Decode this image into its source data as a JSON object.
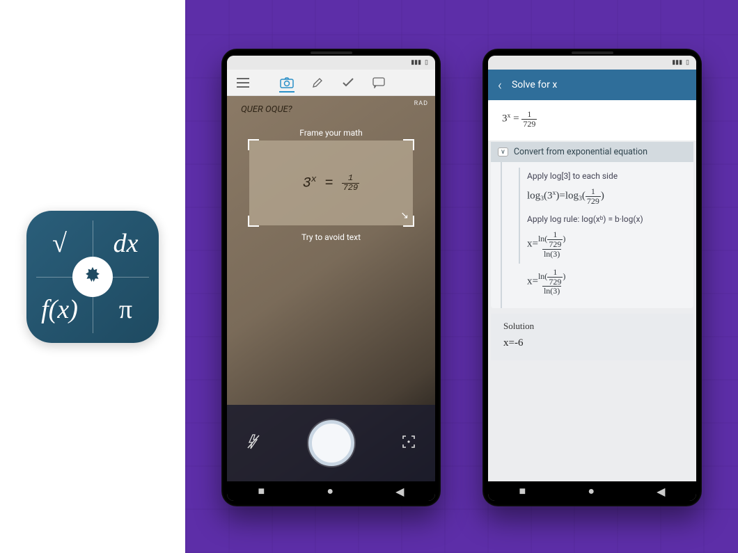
{
  "app_icon": {
    "top_left": "√",
    "top_right": "dx",
    "bottom_left": "f(x)",
    "bottom_right": "π",
    "center_glyph": "leaf-icon"
  },
  "phone1": {
    "status": {
      "signal": "▮▮▮",
      "battery": "▯"
    },
    "tabs": {
      "menu": "menu-icon",
      "camera": "camera-icon",
      "edit": "pencil-icon",
      "check": "check-icon",
      "chat": "chat-icon"
    },
    "camera": {
      "rad": "RAD",
      "frame_label": "Frame your math",
      "avoid_label": "Try to avoid text",
      "captured_expression": "3ˣ = 1⁄729",
      "background_writing": "QUER OQUE?"
    },
    "controls": {
      "flash": "flash-off-icon",
      "capture": "capture-button",
      "fullscreen": "focus-icon"
    },
    "nav": {
      "recent": "■",
      "home": "●",
      "back": "◀"
    }
  },
  "phone2": {
    "status": {
      "signal": "▮▮▮",
      "battery": "▯"
    },
    "header": {
      "back": "‹",
      "title": "Solve for x"
    },
    "equation_top": "3ˣ = 1/729",
    "steps": [
      {
        "title": "Convert from exponential equation",
        "toggle": "v",
        "substeps": [
          {
            "title": "Apply log[3] to each side",
            "math": "log₃(3ˣ) = log₃(1/729)"
          },
          {
            "title": "Apply log rule: log(xᵇ) = b·log(x)",
            "math": "x = ln(1/729) / ln(3)"
          }
        ],
        "result_math": "x = ln(1/729) / ln(3)"
      }
    ],
    "solution": {
      "label": "Solution",
      "value": "x=-6"
    },
    "nav": {
      "recent": "■",
      "home": "●",
      "back": "◀"
    }
  },
  "colors": {
    "brand_blue": "#2f6e9a",
    "purple_bg": "#5d2ea8",
    "icon_bg": "#1e4a61"
  }
}
